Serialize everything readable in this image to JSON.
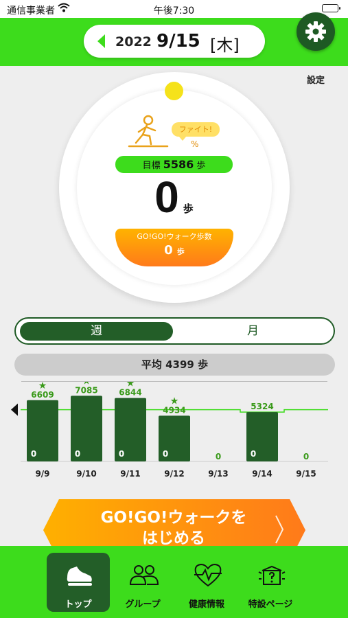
{
  "status_bar": {
    "carrier": "通信事業者",
    "time": "午後7:30"
  },
  "header": {
    "year": "2022",
    "month_day": "9/15",
    "weekday": "[木]",
    "settings_label": "設定"
  },
  "progress": {
    "cheer": "ファイト!",
    "percent_label": "%",
    "goal_prefix": "目標",
    "goal_value": "5586",
    "goal_unit": "歩",
    "steps_today": "0",
    "steps_unit": "歩",
    "gogo_label": "GO!GO!ウォーク歩数",
    "gogo_steps": "0",
    "gogo_unit": "歩",
    "level": 0
  },
  "period_toggle": {
    "week": "週",
    "month": "月",
    "selected": "week"
  },
  "average": {
    "text": "平均 4399 歩"
  },
  "chart_data": {
    "type": "bar",
    "categories": [
      "9/9",
      "9/10",
      "9/11",
      "9/12",
      "9/13",
      "9/14",
      "9/15"
    ],
    "series": [
      {
        "values": [
          6609,
          7085,
          6844,
          4934,
          0,
          5324,
          0
        ]
      }
    ],
    "inner_labels": [
      "0",
      "0",
      "0",
      "0",
      "",
      "0",
      ""
    ],
    "goal_achieved": [
      true,
      true,
      true,
      true,
      false,
      false,
      false
    ],
    "goal_line": [
      5586,
      5586,
      5586,
      5586,
      5586,
      5324,
      5586
    ],
    "ylim": [
      0,
      8000
    ],
    "colors": {
      "bar": "#235e28",
      "label": "#3a9a1a",
      "goal": "#3ddc1c"
    }
  },
  "start_button": {
    "line1": "GO!GO!ウォークを",
    "line2": "はじめる"
  },
  "bottom_nav": [
    {
      "label": "トップ",
      "icon": "shoe-icon",
      "active": true
    },
    {
      "label": "グループ",
      "icon": "group-icon",
      "active": false
    },
    {
      "label": "健康情報",
      "icon": "heart-pulse-icon",
      "active": false
    },
    {
      "label": "特設ページ",
      "icon": "mystery-box-icon",
      "active": false
    }
  ]
}
